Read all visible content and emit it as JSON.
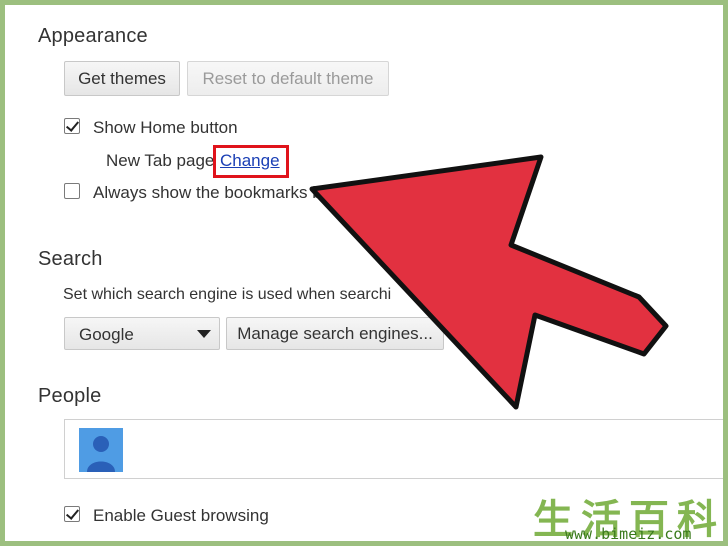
{
  "appearance": {
    "title": "Appearance",
    "get_themes_label": "Get themes",
    "reset_theme_label": "Reset to default theme",
    "show_home_label": "Show Home button",
    "show_home_checked": true,
    "new_tab_label": "New Tab page",
    "change_link_label": "Change",
    "bookmarks_label": "Always show the bookmarks b",
    "bookmarks_checked": false
  },
  "search": {
    "title": "Search",
    "description": "Set which search engine is used when searchi",
    "engine_selected": "Google",
    "manage_label": "Manage search engines..."
  },
  "people": {
    "title": "People",
    "guest_label": "Enable Guest browsing",
    "guest_checked": true
  },
  "watermark": {
    "cn_text": "生活百科",
    "url": "www.bimeiz.com"
  },
  "colors": {
    "arrow_fill": "#e23140",
    "highlight": "#e0131b",
    "link": "#1a3fb5",
    "border_frame": "#9cbf7f"
  }
}
